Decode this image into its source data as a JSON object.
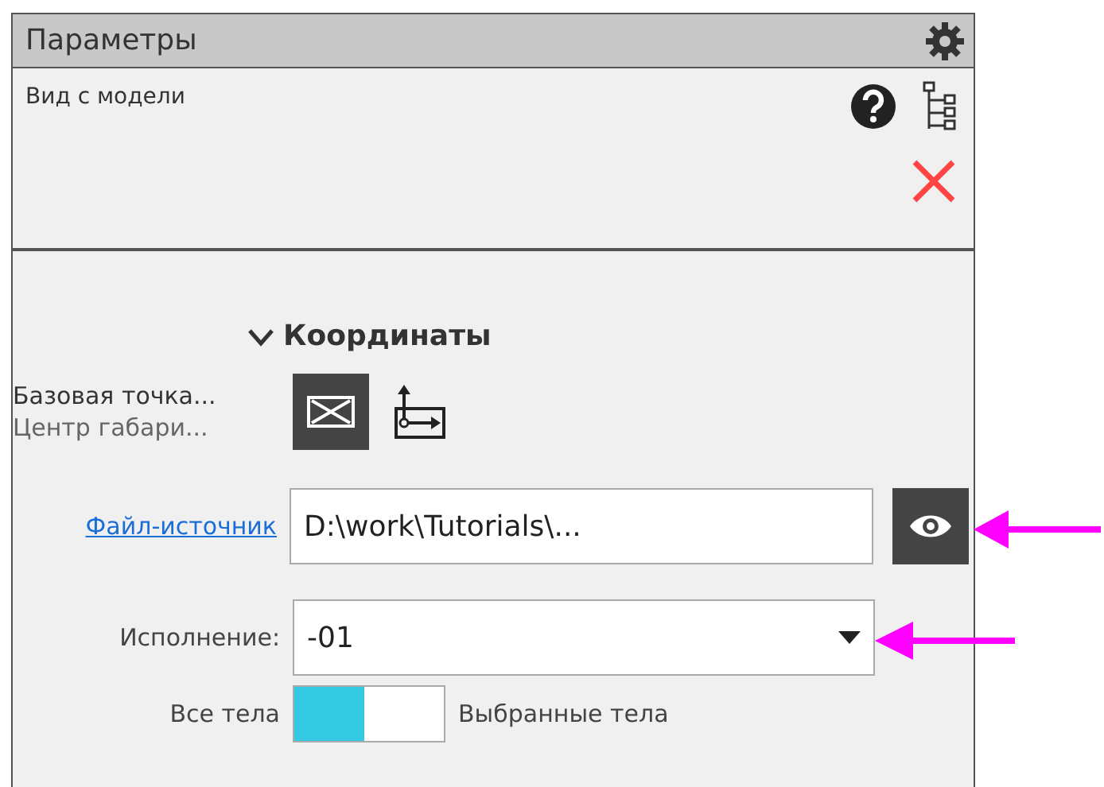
{
  "panel": {
    "title": "Параметры"
  },
  "header": {
    "subtitle": "Вид с модели"
  },
  "section": {
    "title": "Координаты",
    "expanded": true
  },
  "base_point": {
    "label": "Базовая точка...",
    "value": "Центр габари...",
    "buttons": [
      {
        "kind": "center",
        "selected": true
      },
      {
        "kind": "axes",
        "selected": false
      }
    ]
  },
  "source_file": {
    "link": "Файл-источник",
    "value": "D:\\work\\Tutorials\\..."
  },
  "execution": {
    "label": "Исполнение:",
    "value": "-01"
  },
  "bodies": {
    "left_label": "Все тела",
    "right_label": "Выбранные тела",
    "on": false
  }
}
